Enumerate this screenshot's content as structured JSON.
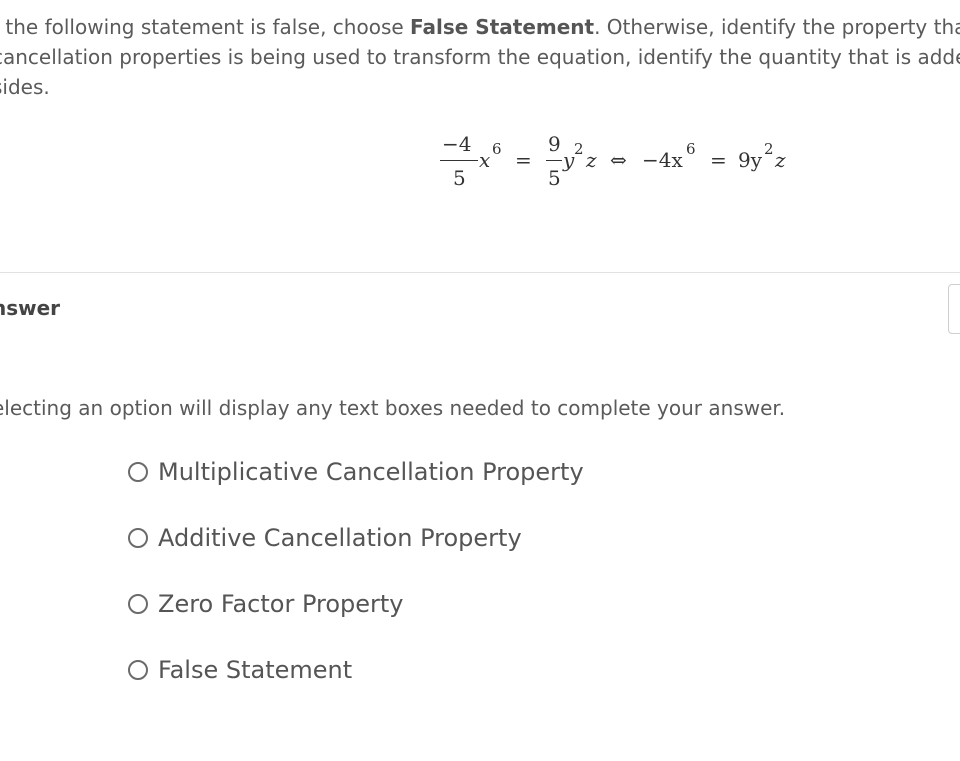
{
  "question": {
    "line1_start": "f the following statement is false, choose ",
    "line1_bold": "False Statement",
    "line1_end": ". Otherwise, identify the property that ju",
    "line2": "cancellation properties is being used to transform the equation, identify the quantity that is added",
    "line3": "sides."
  },
  "equation": {
    "left_numerator": "−4",
    "left_denominator": "5",
    "left_var": "x",
    "left_exp": "6",
    "equals1": "=",
    "mid_numerator": "9",
    "mid_denominator": "5",
    "mid_var": "y",
    "mid_exp": "2",
    "mid_var2": "z",
    "iff": "⇔",
    "right_lhs": "−4x",
    "right_lhs_exp": "6",
    "equals2": "=",
    "right_rhs": "9y",
    "right_rhs_exp": "2",
    "right_rhs_var": "z"
  },
  "answer": {
    "heading": "nswer",
    "instruction": "electing an option will display any text boxes needed to complete your answer.",
    "options": [
      {
        "label": "Multiplicative Cancellation Property",
        "selected": false
      },
      {
        "label": "Additive Cancellation Property",
        "selected": false
      },
      {
        "label": "Zero Factor Property",
        "selected": false
      },
      {
        "label": "False Statement",
        "selected": false
      }
    ]
  },
  "colors": {
    "text": "#555555",
    "divider": "#e2e2e2",
    "radio_border": "#6b6b6b"
  }
}
